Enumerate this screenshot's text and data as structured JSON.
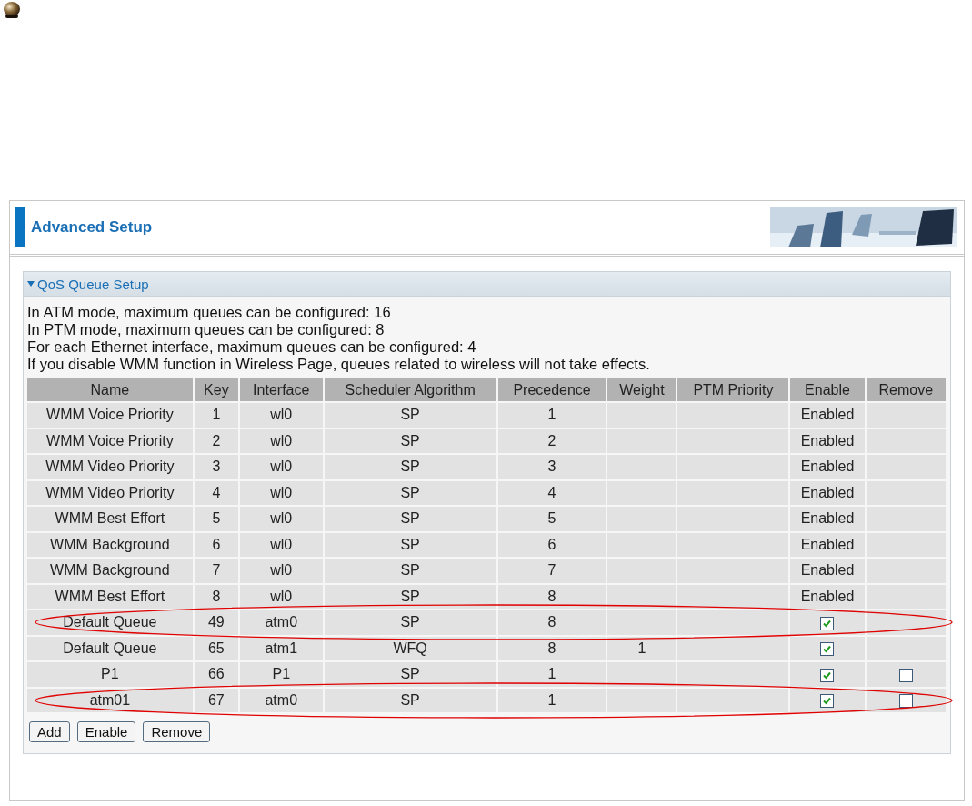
{
  "header": {
    "title": "Advanced Setup"
  },
  "section": {
    "title": "QoS Queue Setup",
    "expanded": true,
    "notes": [
      "In ATM mode, maximum queues can be configured: 16",
      "In PTM mode, maximum queues can be configured: 8",
      "For each Ethernet interface, maximum queues can be configured: 4",
      "If you disable WMM function in Wireless Page, queues related to wireless will not take effects."
    ]
  },
  "table": {
    "columns": [
      "Name",
      "Key",
      "Interface",
      "Scheduler Algorithm",
      "Precedence",
      "Weight",
      "PTM Priority",
      "Enable",
      "Remove"
    ],
    "rows": [
      {
        "name": "WMM Voice Priority",
        "key": "1",
        "interface": "wl0",
        "scheduler": "SP",
        "precedence": "1",
        "weight": "",
        "ptm_priority": "",
        "enable": {
          "kind": "text",
          "text": "Enabled"
        },
        "remove": {
          "kind": "none"
        },
        "highlighted": false
      },
      {
        "name": "WMM Voice Priority",
        "key": "2",
        "interface": "wl0",
        "scheduler": "SP",
        "precedence": "2",
        "weight": "",
        "ptm_priority": "",
        "enable": {
          "kind": "text",
          "text": "Enabled"
        },
        "remove": {
          "kind": "none"
        },
        "highlighted": false
      },
      {
        "name": "WMM Video Priority",
        "key": "3",
        "interface": "wl0",
        "scheduler": "SP",
        "precedence": "3",
        "weight": "",
        "ptm_priority": "",
        "enable": {
          "kind": "text",
          "text": "Enabled"
        },
        "remove": {
          "kind": "none"
        },
        "highlighted": false
      },
      {
        "name": "WMM Video Priority",
        "key": "4",
        "interface": "wl0",
        "scheduler": "SP",
        "precedence": "4",
        "weight": "",
        "ptm_priority": "",
        "enable": {
          "kind": "text",
          "text": "Enabled"
        },
        "remove": {
          "kind": "none"
        },
        "highlighted": false
      },
      {
        "name": "WMM Best Effort",
        "key": "5",
        "interface": "wl0",
        "scheduler": "SP",
        "precedence": "5",
        "weight": "",
        "ptm_priority": "",
        "enable": {
          "kind": "text",
          "text": "Enabled"
        },
        "remove": {
          "kind": "none"
        },
        "highlighted": false
      },
      {
        "name": "WMM Background",
        "key": "6",
        "interface": "wl0",
        "scheduler": "SP",
        "precedence": "6",
        "weight": "",
        "ptm_priority": "",
        "enable": {
          "kind": "text",
          "text": "Enabled"
        },
        "remove": {
          "kind": "none"
        },
        "highlighted": false
      },
      {
        "name": "WMM Background",
        "key": "7",
        "interface": "wl0",
        "scheduler": "SP",
        "precedence": "7",
        "weight": "",
        "ptm_priority": "",
        "enable": {
          "kind": "text",
          "text": "Enabled"
        },
        "remove": {
          "kind": "none"
        },
        "highlighted": false
      },
      {
        "name": "WMM Best Effort",
        "key": "8",
        "interface": "wl0",
        "scheduler": "SP",
        "precedence": "8",
        "weight": "",
        "ptm_priority": "",
        "enable": {
          "kind": "text",
          "text": "Enabled"
        },
        "remove": {
          "kind": "none"
        },
        "highlighted": false
      },
      {
        "name": "Default Queue",
        "key": "49",
        "interface": "atm0",
        "scheduler": "SP",
        "precedence": "8",
        "weight": "",
        "ptm_priority": "",
        "enable": {
          "kind": "checkbox",
          "checked": true
        },
        "remove": {
          "kind": "none"
        },
        "highlighted": true
      },
      {
        "name": "Default Queue",
        "key": "65",
        "interface": "atm1",
        "scheduler": "WFQ",
        "precedence": "8",
        "weight": "1",
        "ptm_priority": "",
        "enable": {
          "kind": "checkbox",
          "checked": true
        },
        "remove": {
          "kind": "none"
        },
        "highlighted": false
      },
      {
        "name": "P1",
        "key": "66",
        "interface": "P1",
        "scheduler": "SP",
        "precedence": "1",
        "weight": "",
        "ptm_priority": "",
        "enable": {
          "kind": "checkbox",
          "checked": true
        },
        "remove": {
          "kind": "checkbox",
          "checked": false
        },
        "highlighted": false
      },
      {
        "name": "atm01",
        "key": "67",
        "interface": "atm0",
        "scheduler": "SP",
        "precedence": "1",
        "weight": "",
        "ptm_priority": "",
        "enable": {
          "kind": "checkbox",
          "checked": true
        },
        "remove": {
          "kind": "checkbox",
          "checked": false
        },
        "highlighted": true
      }
    ]
  },
  "buttons": [
    "Add",
    "Enable",
    "Remove"
  ]
}
